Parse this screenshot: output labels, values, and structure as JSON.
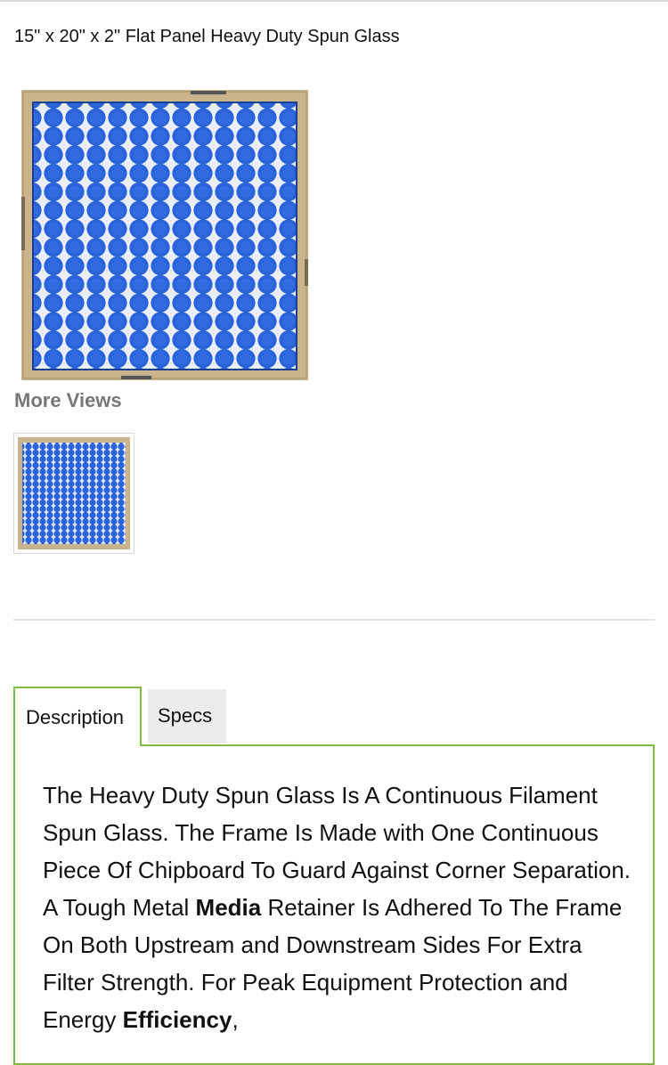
{
  "product": {
    "title": "15\" x 20\" x 2\" Flat Panel Heavy Duty Spun Glass"
  },
  "more_views": {
    "title": "More Views"
  },
  "tabs": {
    "items": [
      {
        "label": "Description",
        "active": true
      },
      {
        "label": "Specs",
        "active": false
      }
    ]
  },
  "description": {
    "part1": "The Heavy Duty Spun Glass Is A Continuous Filament Spun Glass. The Frame Is Made with One Continuous Piece Of Chipboard To Guard Against Corner Separation. A Tough Metal ",
    "bold1": "Media",
    "part2": " Retainer Is Adhered To The Frame On Both Upstream and Downstream Sides For Extra Filter Strength. For Peak Equipment Protection and Energy ",
    "bold2": "Efficiency",
    "part3": ","
  },
  "colors": {
    "tab_border": "#7dbb42",
    "filter_blue": "#2a62da",
    "frame_tan": "#c9b48e",
    "heading_gray": "#777777"
  }
}
